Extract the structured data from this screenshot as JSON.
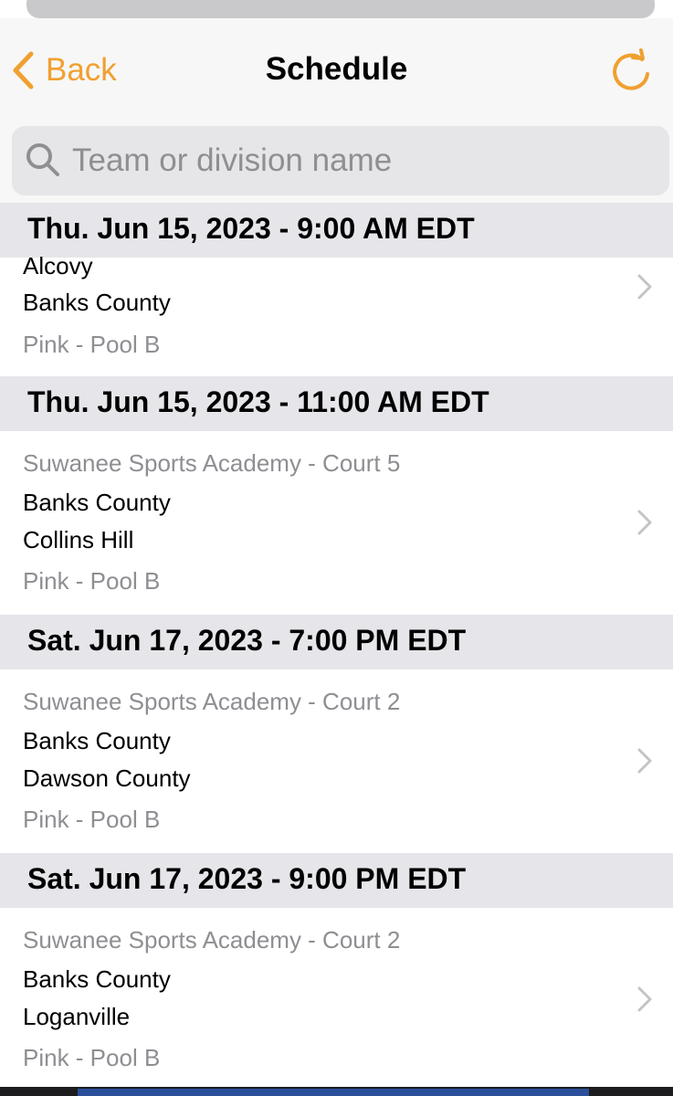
{
  "nav": {
    "back_label": "Back",
    "title": "Schedule",
    "accent_color": "#f0a030",
    "back_icon": "chevron-left-icon",
    "refresh_icon": "refresh-icon"
  },
  "search": {
    "placeholder": "Team or division name",
    "value": "",
    "icon": "search-icon"
  },
  "sections": [
    {
      "header": "Thu. Jun 15, 2023 - 9:00 AM EDT",
      "games": [
        {
          "venue": "",
          "teams": [
            "Alcovy",
            "Banks County"
          ],
          "division": "Pink - Pool B"
        }
      ]
    },
    {
      "header": "Thu. Jun 15, 2023 - 11:00 AM EDT",
      "games": [
        {
          "venue": "Suwanee Sports Academy - Court 5",
          "teams": [
            "Banks County",
            "Collins Hill"
          ],
          "division": "Pink - Pool B"
        }
      ]
    },
    {
      "header": "Sat. Jun 17, 2023 - 7:00 PM EDT",
      "games": [
        {
          "venue": "Suwanee Sports Academy - Court 2",
          "teams": [
            "Banks County",
            "Dawson County"
          ],
          "division": "Pink - Pool B"
        }
      ]
    },
    {
      "header": "Sat. Jun 17, 2023 - 9:00 PM EDT",
      "games": [
        {
          "venue": "Suwanee Sports Academy - Court 2",
          "teams": [
            "Banks County",
            "Loganville"
          ],
          "division": "Pink - Pool B"
        }
      ]
    }
  ]
}
